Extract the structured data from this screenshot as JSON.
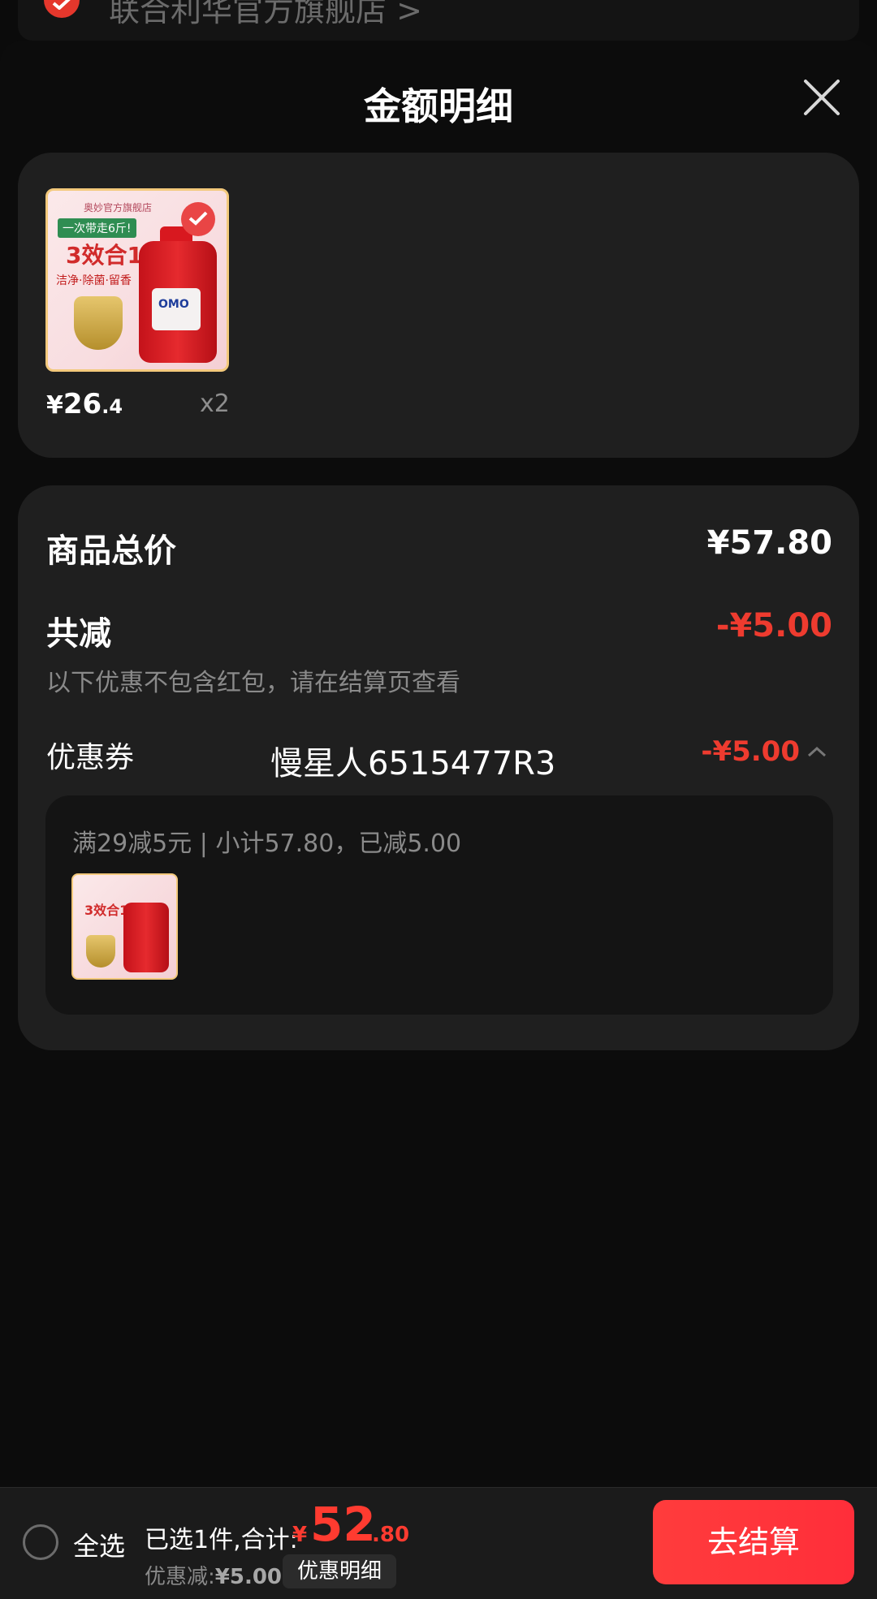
{
  "store": {
    "name": "联合利华官方旗舰店 >"
  },
  "sheet": {
    "title": "金额明细"
  },
  "product": {
    "price_currency": "¥",
    "price_int": "26",
    "price_dec": ".4",
    "quantity": "x2",
    "thumb": {
      "brand": "奥妙官方旗舰店",
      "tag": "一次带走6斤!",
      "headline": "3效合1",
      "features": "洁净·除菌·留香",
      "bottle_logo": "OMO"
    }
  },
  "breakdown": {
    "total_label": "商品总价",
    "total_value": "¥57.80",
    "reduce_label": "共减",
    "reduce_value": "-¥5.00",
    "note": "以下优惠不包含红包，请在结算页查看",
    "coupon_label": "优惠券",
    "coupon_value": "-¥5.00",
    "coupon_desc": "满29减5元 | 小计57.80，已减5.00",
    "watermark": "慢星人6515477R3"
  },
  "bottom": {
    "select_all": "全选",
    "summary": "已选1件,合计:",
    "total_currency": "¥",
    "total_int": "52",
    "total_dec": ".80",
    "discount_label": "优惠减:",
    "discount_value": "¥5.00",
    "detail_chip": "优惠明细",
    "checkout": "去结算"
  },
  "colors": {
    "accent_red": "#ff3b30",
    "card_bg": "#1f1f1f",
    "page_bg": "#0b0b0b"
  }
}
